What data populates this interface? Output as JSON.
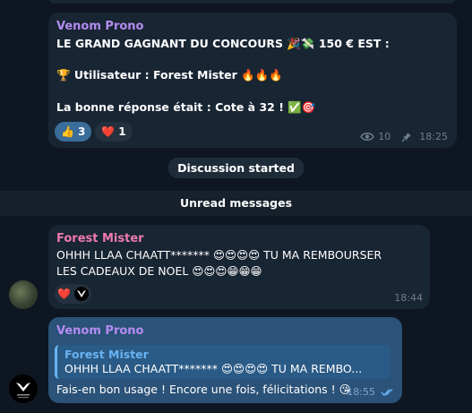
{
  "messages": [
    {
      "sender": "Venom Prono",
      "line1": "LE GRAND GAGNANT DU CONCOURS 🎉💸 150 € EST :",
      "line2": "🏆 Utilisateur : Forest Mister 🔥🔥🔥",
      "line3": "La bonne réponse était : Cote à 32 ! ✅🎯",
      "reactions": [
        {
          "emoji": "👍",
          "count": "3"
        },
        {
          "emoji": "❤️",
          "count": "1"
        }
      ],
      "views": "10",
      "time": "18:25"
    },
    {
      "sender": "Forest Mister",
      "line1": "OHHH LLAA CHAATT******* 😍😍😍😍 TU MA REMBOURSER",
      "line2": "LES CADEAUX DE NOEL 😍😍😍😁😁😁",
      "reaction": "❤️",
      "time": "18:44"
    },
    {
      "sender": "Venom Prono",
      "reply_sender": "Forest Mister",
      "reply_text": "OHHH LLAA CHAATT******* 😍😍😍😍 TU MA REMBO...",
      "text": "Fais-en bon usage ! Encore une fois, félicitations ! 😘",
      "time": "18:55"
    }
  ],
  "service": {
    "discussion_started": "Discussion started",
    "unread": "Unread messages"
  },
  "colors": {
    "background": "#0e1621",
    "incoming_bubble": "#182533",
    "outgoing_bubble": "#2b5278",
    "venom_name": "#b48cf2",
    "forest_name": "#ee7aae",
    "reply_name": "#6ab3f3"
  },
  "icons": [
    "eye-icon",
    "pin-icon",
    "double-check-icon",
    "venom-avatar-logo"
  ]
}
